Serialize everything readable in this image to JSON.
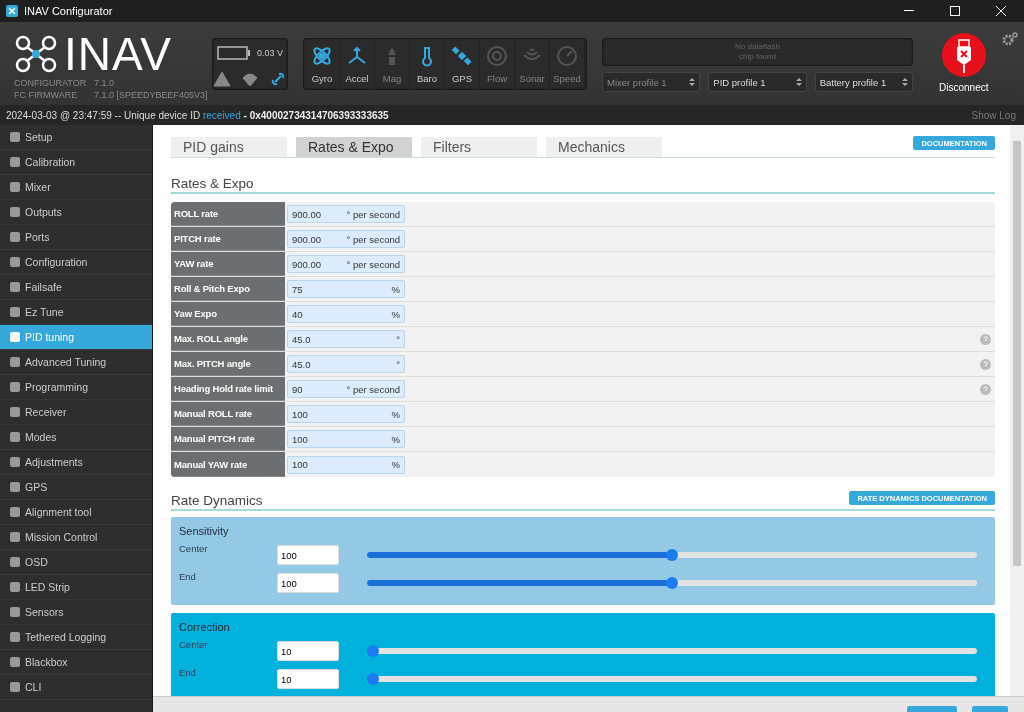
{
  "window": {
    "title": "INAV Configurator"
  },
  "header": {
    "logo": "INAV",
    "versions": [
      {
        "label": "CONFIGURATOR",
        "value": "7.1.0"
      },
      {
        "label": "FC FIRMWARE",
        "value": "7.1.0 [SPEEDYBEEF405V3]"
      }
    ],
    "battery": {
      "voltage": "0.03 V",
      "indicators": [
        {
          "kind": "warning",
          "on": false
        },
        {
          "kind": "failsafe",
          "on": false
        },
        {
          "kind": "link",
          "on": true
        }
      ]
    },
    "sensors": [
      {
        "label": "Gyro",
        "kind": "gyro",
        "on": true
      },
      {
        "label": "Accel",
        "kind": "accel",
        "on": true
      },
      {
        "label": "Mag",
        "kind": "mag",
        "on": false
      },
      {
        "label": "Baro",
        "kind": "baro",
        "on": true
      },
      {
        "label": "GPS",
        "kind": "gps",
        "on": true
      },
      {
        "label": "Flow",
        "kind": "flow",
        "on": false
      },
      {
        "label": "Sonar",
        "kind": "sonar",
        "on": false
      },
      {
        "label": "Speed",
        "kind": "speed",
        "on": false
      }
    ],
    "dataflash": [
      "No dataflash",
      "chip found"
    ],
    "profiles": [
      {
        "value": "Mixer profile 1",
        "disabled": true
      },
      {
        "value": "PID profile 1",
        "disabled": false
      },
      {
        "value": "Battery profile 1",
        "disabled": false
      }
    ],
    "connect_button": "Disconnect"
  },
  "status_bar": {
    "timestamp": "2024-03-03 @ 23:47:59 -- Unique device ID",
    "state": "received",
    "device_id": "- 0x40002734314706393333635",
    "show_log": "Show Log"
  },
  "sidebar": {
    "items": [
      {
        "label": "Setup",
        "selected": false
      },
      {
        "label": "Calibration",
        "selected": false
      },
      {
        "label": "Mixer",
        "selected": false
      },
      {
        "label": "Outputs",
        "selected": false
      },
      {
        "label": "Ports",
        "selected": false
      },
      {
        "label": "Configuration",
        "selected": false
      },
      {
        "label": "Failsafe",
        "selected": false
      },
      {
        "label": "Ez Tune",
        "selected": false
      },
      {
        "label": "PID tuning",
        "selected": true
      },
      {
        "label": "Advanced Tuning",
        "selected": false
      },
      {
        "label": "Programming",
        "selected": false
      },
      {
        "label": "Receiver",
        "selected": false
      },
      {
        "label": "Modes",
        "selected": false
      },
      {
        "label": "Adjustments",
        "selected": false
      },
      {
        "label": "GPS",
        "selected": false
      },
      {
        "label": "Alignment tool",
        "selected": false
      },
      {
        "label": "Mission Control",
        "selected": false
      },
      {
        "label": "OSD",
        "selected": false
      },
      {
        "label": "LED Strip",
        "selected": false
      },
      {
        "label": "Sensors",
        "selected": false
      },
      {
        "label": "Tethered Logging",
        "selected": false
      },
      {
        "label": "Blackbox",
        "selected": false
      },
      {
        "label": "CLI",
        "selected": false
      }
    ]
  },
  "tabs": [
    {
      "label": "PID gains",
      "selected": false
    },
    {
      "label": "Rates & Expo",
      "selected": true
    },
    {
      "label": "Filters",
      "selected": false
    },
    {
      "label": "Mechanics",
      "selected": false
    }
  ],
  "documentation_button": "DOCUMENTATION",
  "rates": {
    "title": "Rates & Expo",
    "rows": [
      {
        "label": "ROLL rate",
        "value": "900.00",
        "unit": "° per second",
        "help": false
      },
      {
        "label": "PITCH rate",
        "value": "900.00",
        "unit": "° per second",
        "help": false
      },
      {
        "label": "YAW rate",
        "value": "900.00",
        "unit": "° per second",
        "help": false
      },
      {
        "label": "Roll & Pitch Expo",
        "value": "75",
        "unit": "%",
        "help": false
      },
      {
        "label": "Yaw Expo",
        "value": "40",
        "unit": "%",
        "help": false
      },
      {
        "label": "Max. ROLL angle",
        "value": "45.0",
        "unit": "°",
        "help": true
      },
      {
        "label": "Max. PITCH angle",
        "value": "45.0",
        "unit": "°",
        "help": true
      },
      {
        "label": "Heading Hold rate limit",
        "value": "90",
        "unit": "° per second",
        "help": true
      },
      {
        "label": "Manual ROLL rate",
        "value": "100",
        "unit": "%",
        "help": false
      },
      {
        "label": "Manual PITCH rate",
        "value": "100",
        "unit": "%",
        "help": false
      },
      {
        "label": "Manual YAW rate",
        "value": "100",
        "unit": "%",
        "help": false
      }
    ]
  },
  "rate_dynamics": {
    "title": "Rate Dynamics",
    "documentation_button": "RATE DYNAMICS DOCUMENTATION",
    "groups": [
      {
        "title": "Sensitivity",
        "color": "#94c9e6",
        "rows": [
          {
            "label": "Center",
            "value": "100",
            "level": 0.5
          },
          {
            "label": "End",
            "value": "100",
            "level": 0.5
          }
        ]
      },
      {
        "title": "Correction",
        "color": "#00b1dc",
        "rows": [
          {
            "label": "Center",
            "value": "10",
            "level": 0.0
          },
          {
            "label": "End",
            "value": "10",
            "level": 0.0
          }
        ]
      }
    ]
  }
}
